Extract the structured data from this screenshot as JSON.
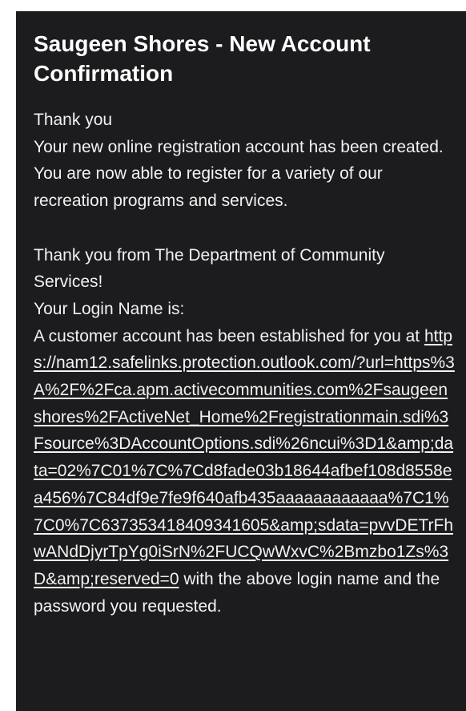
{
  "email": {
    "subject": "Saugeen Shores - New Account Confirmation",
    "greeting": "Thank you",
    "paragraph1": "Your new online registration account has been created. You are now able to register for a variety of our recreation programs and services.",
    "thanks": "Thank you from The Department of Community Services!",
    "login_name_label": "Your Login Name is:",
    "account_prefix": "A customer account has been established for you at ",
    "link_url": "https://nam12.safelinks.protection.outlook.com/?url=https%3A%2F%2Fca.apm.activecommunities.com%2Fsaugeenshores%2FActiveNet_Home%2Fregistrationmain.sdi%3Fsource%3DAccountOptions.sdi%26ncui%3D1&amp;data=02%7C01%7C%7Cd8fade03b18644afbef108d8558ea456%7C84df9e7fe9f640afb435aaaaaaaaaaaa%7C1%7C0%7C637353418409341605&amp;sdata=pvvDETrFhwANdDjyrTpYg0iSrN%2FUCQwWxvC%2Bmzbo1Zs%3D&amp;reserved=0",
    "account_suffix": " with the above login name and the password you requested."
  }
}
